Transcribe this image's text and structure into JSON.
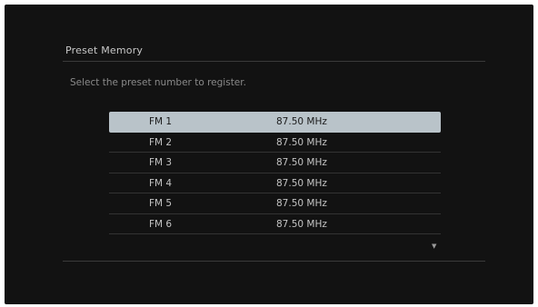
{
  "dialog": {
    "title": "Preset Memory",
    "instruction": "Select the preset number to register."
  },
  "presets": [
    {
      "name": "FM 1",
      "frequency": "87.50 MHz",
      "selected": true
    },
    {
      "name": "FM 2",
      "frequency": "87.50 MHz",
      "selected": false
    },
    {
      "name": "FM 3",
      "frequency": "87.50 MHz",
      "selected": false
    },
    {
      "name": "FM 4",
      "frequency": "87.50 MHz",
      "selected": false
    },
    {
      "name": "FM 5",
      "frequency": "87.50 MHz",
      "selected": false
    },
    {
      "name": "FM 6",
      "frequency": "87.50 MHz",
      "selected": false
    }
  ],
  "scroll": {
    "down_indicator": "▼",
    "icon": "chevron-down-icon"
  },
  "colors": {
    "background": "#121212",
    "highlight": "#b9c3c9",
    "text": "#c4c4c4"
  }
}
